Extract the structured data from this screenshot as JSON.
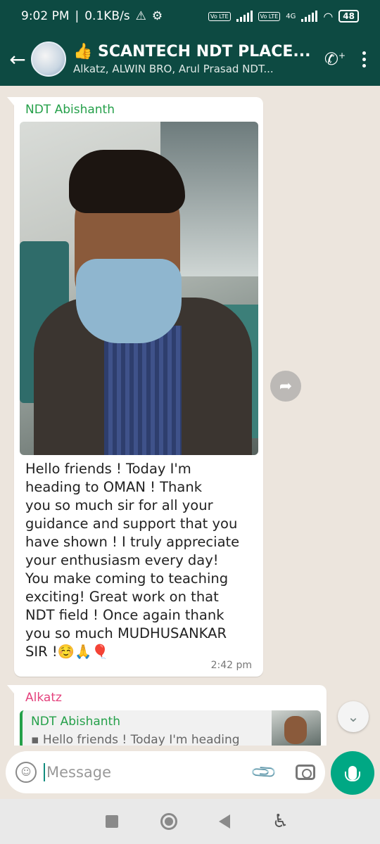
{
  "status_bar": {
    "time": "9:02 PM",
    "speed": "0.1KB/s",
    "volte1": "Vo LTE",
    "volte2": "Vo LTE",
    "network": "4G",
    "battery": "48"
  },
  "header": {
    "title": "👍 SCANTECH NDT PLACE...",
    "subtitle": "Alkatz, ALWIN BRO, Arul Prasad NDT..."
  },
  "messages": [
    {
      "sender": "NDT Abishanth",
      "text": "Hello friends ! Today I'm\nheading to OMAN ! Thank\nyou so much sir for all your\nguidance and support that you\nhave shown ! I truly appreciate\nyour enthusiasm every day!\nYou make coming to teaching\nexciting! Great work on that\nNDT field ! Once again thank\nyou so much MUDHUSANKAR\nSIR !",
      "emojis": "☺️🙏🎈",
      "time": "2:42 pm"
    },
    {
      "sender": "Alkatz",
      "quote_sender": "NDT Abishanth",
      "quote_text": "▪ Hello friends ! Today I'm heading"
    }
  ],
  "composer": {
    "placeholder": "Message"
  },
  "colors": {
    "header_bg": "#0d4a42",
    "chat_bg": "#ece5dd",
    "sender_green": "#25a04a",
    "sender_pink": "#e4427d",
    "mic_green": "#00a884"
  }
}
